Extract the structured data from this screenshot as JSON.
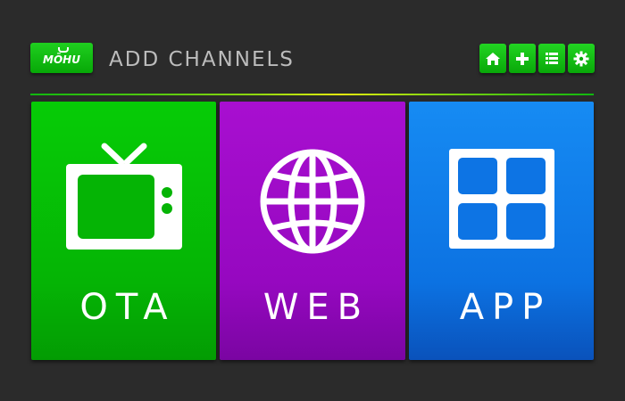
{
  "header": {
    "logo_text": "MŌHU",
    "title": "ADD CHANNELS"
  },
  "nav": {
    "buttons": [
      {
        "name": "home",
        "icon": "home-icon"
      },
      {
        "name": "add",
        "icon": "plus-icon"
      },
      {
        "name": "list",
        "icon": "list-icon"
      },
      {
        "name": "settings",
        "icon": "gear-icon"
      }
    ]
  },
  "tiles": [
    {
      "label": "OTA",
      "icon": "tv-icon",
      "color": "#05b405"
    },
    {
      "label": "WEB",
      "icon": "globe-icon",
      "color": "#9608c0"
    },
    {
      "label": "APP",
      "icon": "grid-icon",
      "color": "#0c72e2"
    }
  ],
  "colors": {
    "background": "#2b2b2b",
    "accent_green": "#09a809",
    "title_text": "#bcbcbc"
  }
}
